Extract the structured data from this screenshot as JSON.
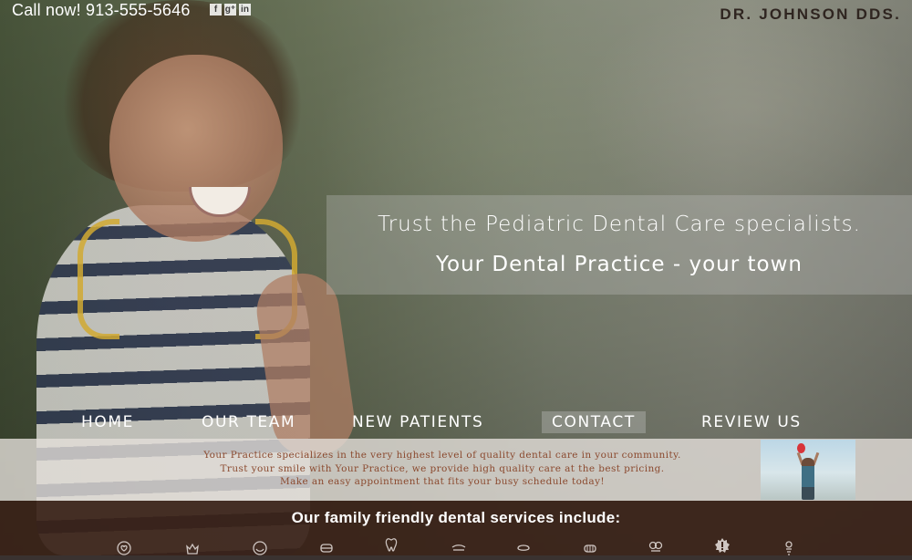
{
  "topbar": {
    "phone": "Call now! 913-555-5646",
    "social": [
      {
        "icon": "facebook-icon",
        "glyph": "f"
      },
      {
        "icon": "google-plus-icon",
        "glyph": "g⁺"
      },
      {
        "icon": "linkedin-icon",
        "glyph": "in"
      }
    ],
    "brand": "DR. JOHNSON DDS."
  },
  "hero": {
    "line1": "Trust the Pediatric Dental Care specialists.",
    "line2": "Your Dental Practice - your town"
  },
  "nav": {
    "items": [
      {
        "label": "HOME"
      },
      {
        "label": "OUR TEAM"
      },
      {
        "label": "NEW PATIENTS"
      },
      {
        "label": "CONTACT",
        "active": true
      },
      {
        "label": "REVIEW US"
      }
    ]
  },
  "info": {
    "line1": "Your Practice specializes in the very highest level of quality dental care in your community.",
    "line2": "Trust your smile with Your Practice, we provide high quality care at the best pricing.",
    "line3": "Make an easy appointment that fits your busy schedule today!"
  },
  "services": {
    "title": "Our family friendly dental services include:",
    "icons": [
      "heart-tooth-icon",
      "tooth-crown-icon",
      "smile-icon",
      "braces-icon",
      "tooth-icon",
      "mouthguard-icon",
      "gum-icon",
      "dentures-icon",
      "floss-icon",
      "badge-icon",
      "implant-icon"
    ]
  },
  "colors": {
    "brand": "#2f2520",
    "info_text": "#8b4a2f",
    "services_band": "#3a2218"
  }
}
